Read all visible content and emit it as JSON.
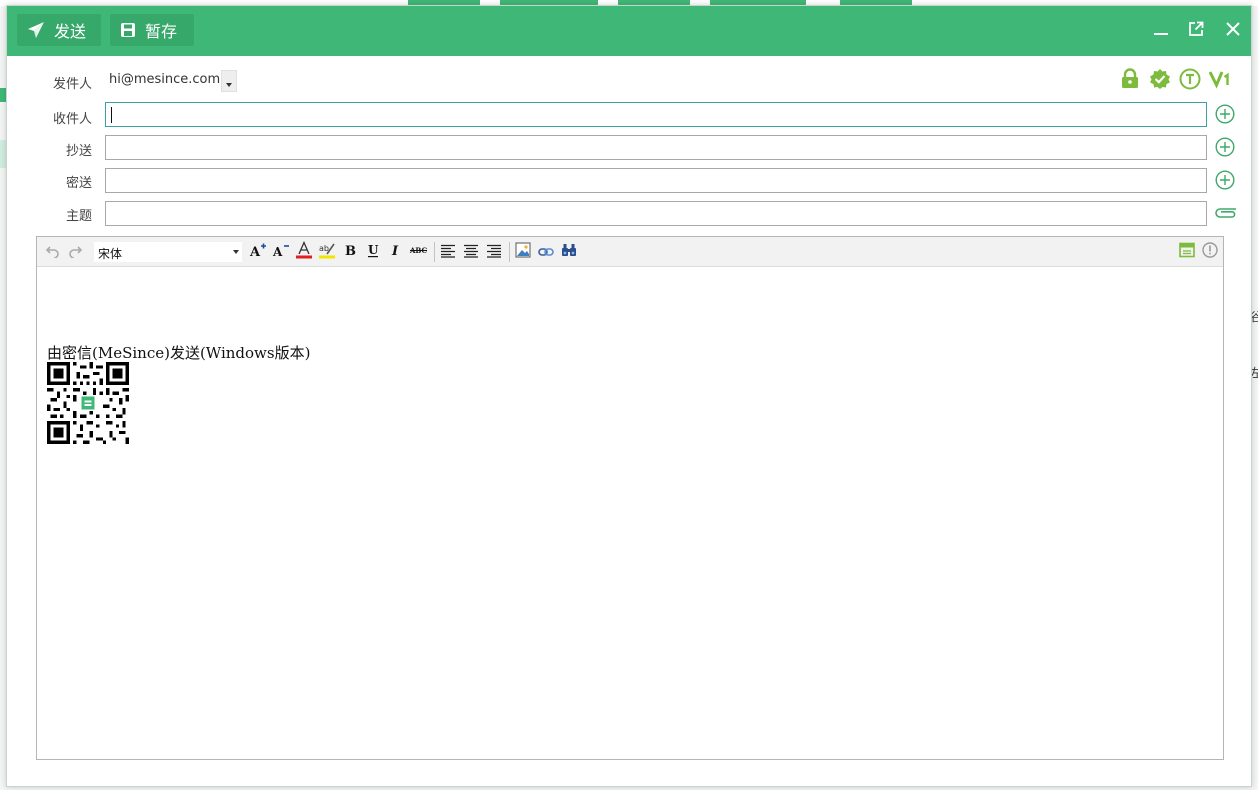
{
  "window": {
    "send_label": "发送",
    "draft_label": "暂存"
  },
  "form": {
    "from_label": "发件人",
    "from_value": "hi@mesince.com",
    "to_label": "收件人",
    "to_value": "",
    "cc_label": "抄送",
    "cc_value": "",
    "bcc_label": "密送",
    "bcc_value": "",
    "subject_label": "主题",
    "subject_value": ""
  },
  "editor": {
    "font_name": "宋体",
    "signature_text": "由密信(MeSince)发送(Windows版本)"
  },
  "background": {
    "right_text_1": "谷",
    "right_text_2": "左"
  },
  "colors": {
    "brand_green": "#3fb877",
    "accent_teal": "#3aa0a6"
  }
}
